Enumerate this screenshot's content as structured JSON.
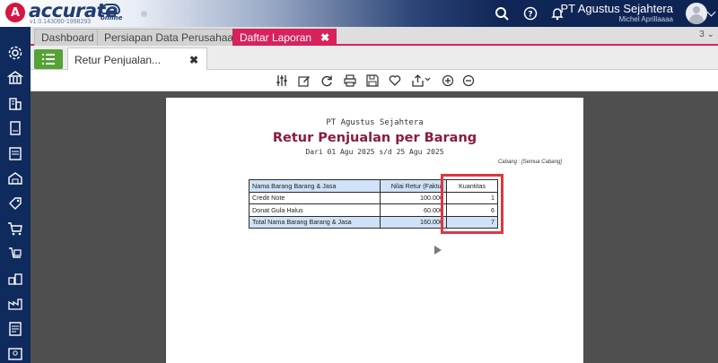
{
  "app": {
    "logo_letter": "A",
    "brand": "accurate",
    "brand_sub": "online",
    "version": "v1.0.143090-1998293"
  },
  "header": {
    "company": "PT Agustus Sejahtera",
    "user": "Michel Aprillaaaa",
    "icons": [
      "search-icon",
      "help-icon",
      "bell-icon",
      "avatar",
      "chevron-down-icon"
    ]
  },
  "sidebar": {
    "items": [
      "gear-icon",
      "bank-icon",
      "building-icon",
      "book-icon",
      "ledger-icon",
      "box-icon",
      "cart-icon",
      "purchase-icon",
      "inventory-icon",
      "factory-icon",
      "report-icon",
      "contact-icon"
    ]
  },
  "module_tabs": [
    {
      "label": "Dashboard",
      "active": false
    },
    {
      "label": "Persiapan Data Perusahaan",
      "active": false
    },
    {
      "label": "Daftar Laporan",
      "active": true,
      "close": "✖"
    }
  ],
  "tab_count": "3 ⌄",
  "sub_tab": {
    "label": "Retur Penjualan...",
    "close": "✖"
  },
  "toolbar_icons": [
    "filter-icon",
    "edit-icon",
    "refresh-icon",
    "print-icon",
    "save-icon",
    "favorite-icon",
    "export-icon",
    "zoom-in-icon",
    "zoom-out-icon"
  ],
  "report": {
    "company": "PT Agustus Sejahtera",
    "title": "Retur Penjualan per Barang",
    "period": "Dari 01 Agu 2025 s/d 25 Agu 2025",
    "branch": "Cabang : [Semua Cabang]",
    "columns": [
      "Nama Barang Barang & Jasa",
      "Nilai Retur (Faktur",
      "Kuantitas"
    ],
    "rows": [
      {
        "name": "Credit Note",
        "value": "100.000",
        "qty": "1"
      },
      {
        "name": "Donat Gula Halus",
        "value": "60.000",
        "qty": "6"
      }
    ],
    "total": {
      "name": "Total Nama Barang Barang & Jasa",
      "value": "160.000",
      "qty": "7"
    }
  },
  "colors": {
    "accent": "#d8225c",
    "navy": "#0f2a5c",
    "report_title": "#8a1b3e",
    "highlight": "#e0363f",
    "list_button": "#55a235"
  }
}
